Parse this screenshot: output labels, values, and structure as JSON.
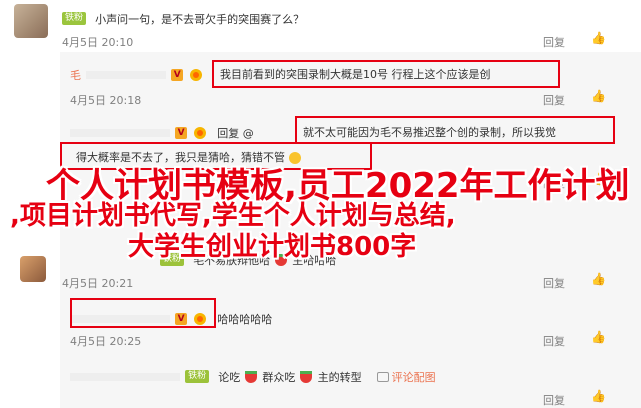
{
  "rows": [
    {
      "name": "",
      "badge": "铁粉",
      "text": "小声问一句，是不去哥欠手的突围赛了么？",
      "date": "4月5日 20:10",
      "reply": "回复",
      "thumb": "👍"
    },
    {
      "name": "毛",
      "text": "我目前看到的突围录制大概是10号 行程上这个应该是创",
      "date": "4月5日 20:18",
      "reply": "回复",
      "thumb": "👍"
    },
    {
      "reply_prefix": "回复 @",
      "text": "就不太可能因为毛不易推迟整个创的录制，所以我觉",
      "text2": "得大概率是不去了，我只是猜哈，猜错不管",
      "date": "",
      "reply": "回复",
      "thumb": "👍"
    },
    {
      "badge": "铁粉",
      "text": "毛不易肤辩他哈",
      "text_suffix": "主哈哈哈",
      "date": "4月5日 20:21",
      "reply": "回复",
      "thumb": "👍"
    },
    {
      "text": "哈哈哈哈哈",
      "date": "4月5日 20:25",
      "reply": "回复",
      "thumb": "👍"
    },
    {
      "badge": "铁粉",
      "text_a": "论吃",
      "text_b": "群众吃",
      "text_c": "主的转型",
      "link": "评论配图",
      "reply": "回复",
      "thumb": "👍"
    }
  ],
  "watermark": {
    "line1": "个人计划书模板,员工2022年工作计划",
    "line2": ",项目计划书代写,学生个人计划与总结,",
    "line3": "大学生创业计划书800字"
  }
}
